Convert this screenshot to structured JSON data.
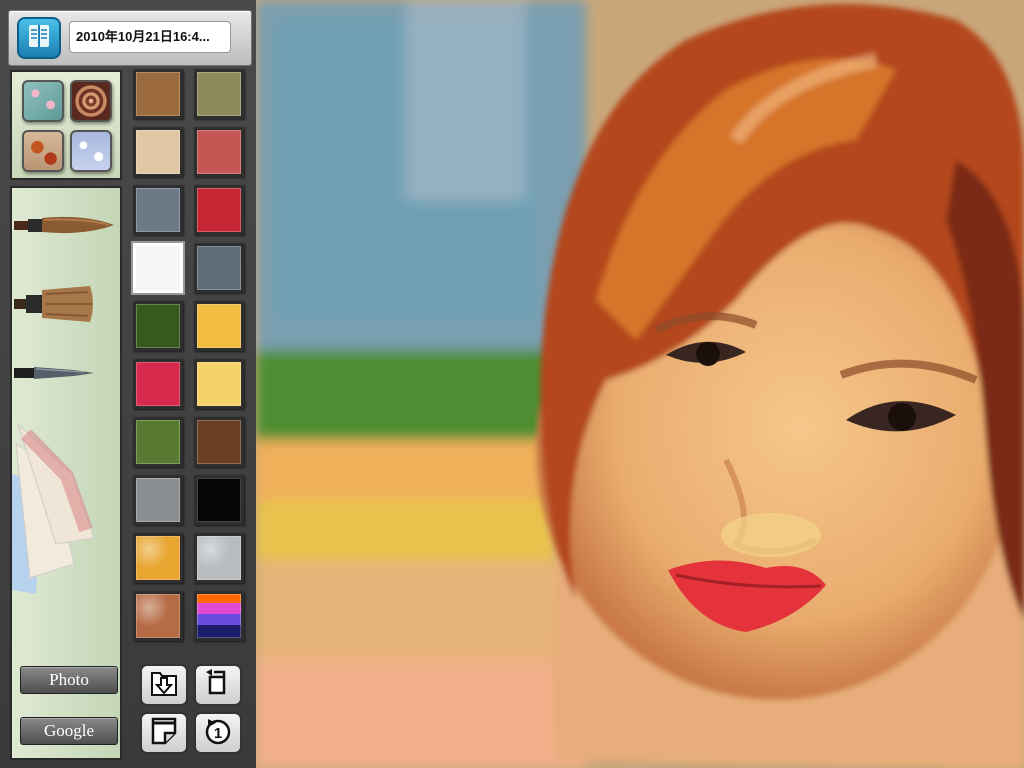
{
  "header": {
    "doc_title": "2010年10月21日16:4..."
  },
  "icons": {
    "library": "book-icon",
    "save": "save-download-icon",
    "rotate": "rotate-icon",
    "new_page": "new-page-icon",
    "undo": "undo-icon"
  },
  "textures": [
    "flowers-pattern",
    "ammonite-shell",
    "autumn-leaves",
    "snowflakes"
  ],
  "tools": [
    "round-brush",
    "flat-brush",
    "pen",
    "paper-samples"
  ],
  "buttons": {
    "photo": "Photo",
    "google": "Google"
  },
  "palette": [
    {
      "color": "#9b6a3d"
    },
    {
      "color": "#8f8a5c"
    },
    {
      "color": "#e2c7a4"
    },
    {
      "color": "#c65654"
    },
    {
      "color": "#6b7a86"
    },
    {
      "color": "#c62633"
    },
    {
      "color": "#f4f6f8",
      "selected": true
    },
    {
      "color": "#5f6c77"
    },
    {
      "color": "#365a1e"
    },
    {
      "color": "#f0bd42"
    },
    {
      "color": "#d52a4c"
    },
    {
      "color": "#f7d268"
    },
    {
      "color": "#5a7a32"
    },
    {
      "color": "#6a3e20"
    },
    {
      "color": "#8a8e91"
    },
    {
      "color": "#050505"
    },
    {
      "color": "#e8a530",
      "kind": "texture"
    },
    {
      "color": "#b8bcbf",
      "kind": "texture"
    },
    {
      "color": "#b56b45",
      "kind": "texture"
    },
    {
      "color": "#e04ad0",
      "kind": "gradient"
    }
  ]
}
